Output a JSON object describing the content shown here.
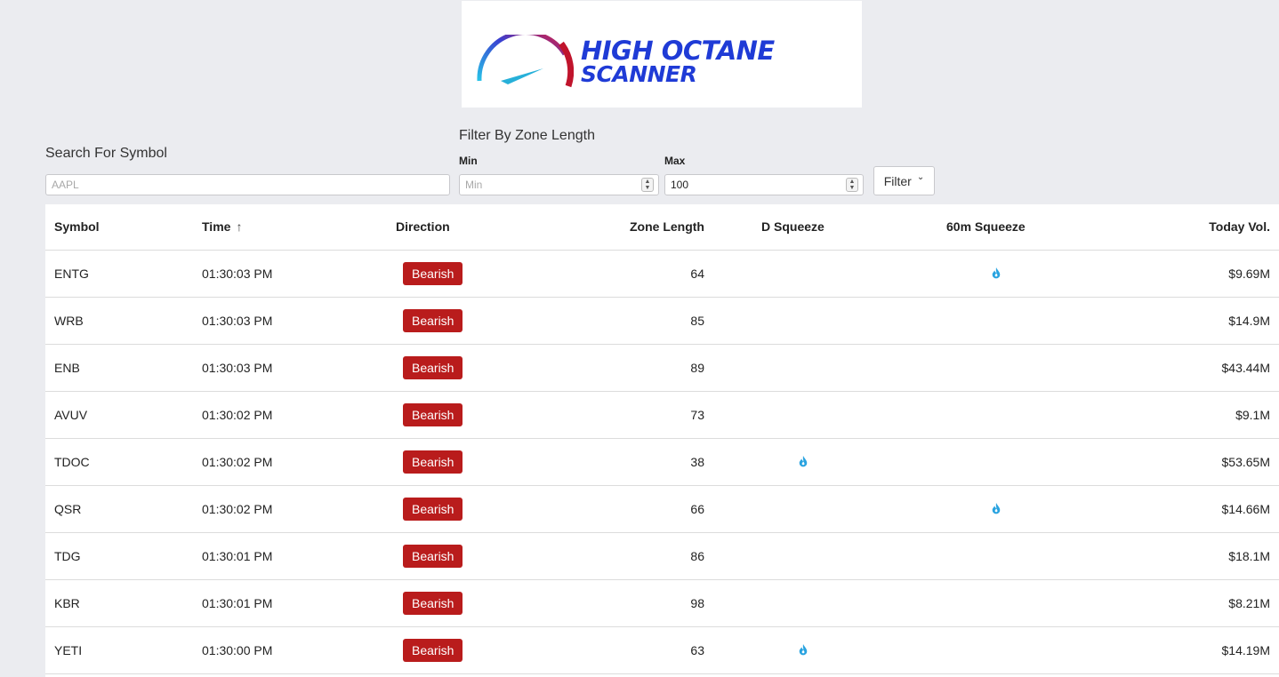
{
  "logo": {
    "line1": "HIGH OCTANE",
    "line2": "SCANNER"
  },
  "search": {
    "label": "Search For Symbol",
    "placeholder": "AAPL",
    "value": ""
  },
  "zone_filter": {
    "label": "Filter By Zone Length",
    "min_label": "Min",
    "min_placeholder": "Min",
    "min_value": "",
    "max_label": "Max",
    "max_value": "100",
    "button_label": "Filter"
  },
  "table": {
    "headers": {
      "symbol": "Symbol",
      "time": "Time",
      "direction": "Direction",
      "zone_length": "Zone Length",
      "d_squeeze": "D Squeeze",
      "squeeze_60m": "60m Squeeze",
      "today_vol": "Today Vol."
    },
    "sort": {
      "column": "Time",
      "direction": "ascending"
    },
    "rows": [
      {
        "symbol": "ENTG",
        "time": "01:30:03 PM",
        "direction": "Bearish",
        "zone_length": "64",
        "d_squeeze": false,
        "squeeze_60m": true,
        "today_vol": "$9.69M"
      },
      {
        "symbol": "WRB",
        "time": "01:30:03 PM",
        "direction": "Bearish",
        "zone_length": "85",
        "d_squeeze": false,
        "squeeze_60m": false,
        "today_vol": "$14.9M"
      },
      {
        "symbol": "ENB",
        "time": "01:30:03 PM",
        "direction": "Bearish",
        "zone_length": "89",
        "d_squeeze": false,
        "squeeze_60m": false,
        "today_vol": "$43.44M"
      },
      {
        "symbol": "AVUV",
        "time": "01:30:02 PM",
        "direction": "Bearish",
        "zone_length": "73",
        "d_squeeze": false,
        "squeeze_60m": false,
        "today_vol": "$9.1M"
      },
      {
        "symbol": "TDOC",
        "time": "01:30:02 PM",
        "direction": "Bearish",
        "zone_length": "38",
        "d_squeeze": true,
        "squeeze_60m": false,
        "today_vol": "$53.65M"
      },
      {
        "symbol": "QSR",
        "time": "01:30:02 PM",
        "direction": "Bearish",
        "zone_length": "66",
        "d_squeeze": false,
        "squeeze_60m": true,
        "today_vol": "$14.66M"
      },
      {
        "symbol": "TDG",
        "time": "01:30:01 PM",
        "direction": "Bearish",
        "zone_length": "86",
        "d_squeeze": false,
        "squeeze_60m": false,
        "today_vol": "$18.1M"
      },
      {
        "symbol": "KBR",
        "time": "01:30:01 PM",
        "direction": "Bearish",
        "zone_length": "98",
        "d_squeeze": false,
        "squeeze_60m": false,
        "today_vol": "$8.21M"
      },
      {
        "symbol": "YETI",
        "time": "01:30:00 PM",
        "direction": "Bearish",
        "zone_length": "63",
        "d_squeeze": true,
        "squeeze_60m": false,
        "today_vol": "$14.19M"
      }
    ]
  },
  "icons": {
    "squeeze": "flame-drop-icon",
    "sort": "arrow-up-icon"
  },
  "colors": {
    "bearish": "#b91c1c",
    "squeeze_icon": "#29a3e0",
    "logo_blue": "#1f3bd6"
  }
}
